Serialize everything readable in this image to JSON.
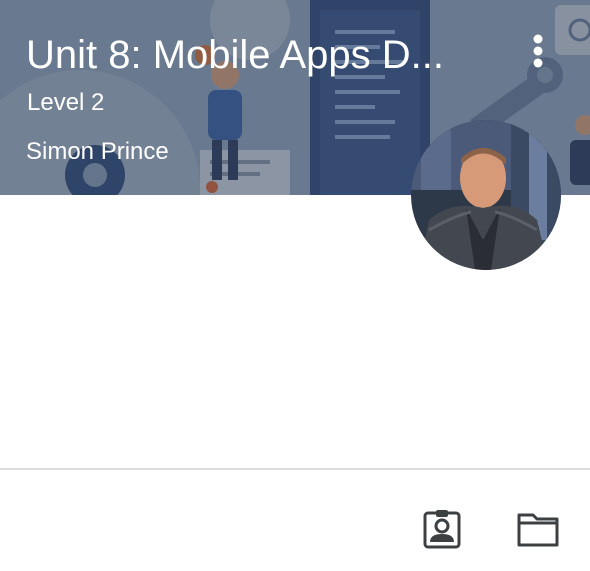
{
  "course": {
    "title": "Unit 8: Mobile Apps D...",
    "section": "Level 2",
    "teacher": "Simon Prince"
  },
  "icons": {
    "menu": "more-vert-icon",
    "avatar": "teacher-avatar",
    "assignments": "assignment-ind-icon",
    "folder": "folder-icon"
  },
  "colors": {
    "header_overlay": "#303846",
    "header_text": "#ffffff",
    "icon": "#3c4043",
    "divider": "#dadce0",
    "background": "#ffffff"
  }
}
